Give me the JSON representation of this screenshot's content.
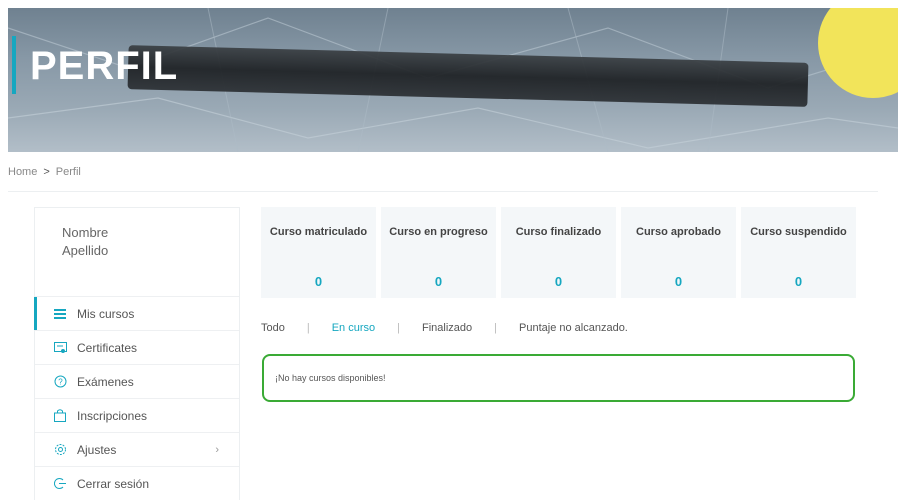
{
  "banner": {
    "title": "PERFIL"
  },
  "breadcrumb": {
    "home": "Home",
    "separator": ">",
    "current": "Perfil"
  },
  "profile": {
    "first_name": "Nombre",
    "last_name": "Apellido"
  },
  "sidebar": {
    "items": [
      {
        "label": "Mis cursos",
        "icon": "list-icon",
        "active": true
      },
      {
        "label": "Certificates",
        "icon": "certificate-icon"
      },
      {
        "label": "Exámenes",
        "icon": "exam-icon"
      },
      {
        "label": "Inscripciones",
        "icon": "bag-icon"
      },
      {
        "label": "Ajustes",
        "icon": "gear-icon",
        "chevron": "›"
      },
      {
        "label": "Cerrar sesión",
        "icon": "logout-icon"
      }
    ]
  },
  "stats": [
    {
      "label": "Curso matriculado",
      "value": "0"
    },
    {
      "label": "Curso en progreso",
      "value": "0"
    },
    {
      "label": "Curso finalizado",
      "value": "0"
    },
    {
      "label": "Curso aprobado",
      "value": "0"
    },
    {
      "label": "Curso suspendido",
      "value": "0"
    }
  ],
  "filters": {
    "all": "Todo",
    "in_progress": "En curso",
    "finished": "Finalizado",
    "score_not_reached": "Puntaje no alcanzado.",
    "separator": "|"
  },
  "empty_message": "¡No hay cursos disponibles!",
  "colors": {
    "accent": "#16a7c0",
    "success_border": "#3aaa35"
  }
}
